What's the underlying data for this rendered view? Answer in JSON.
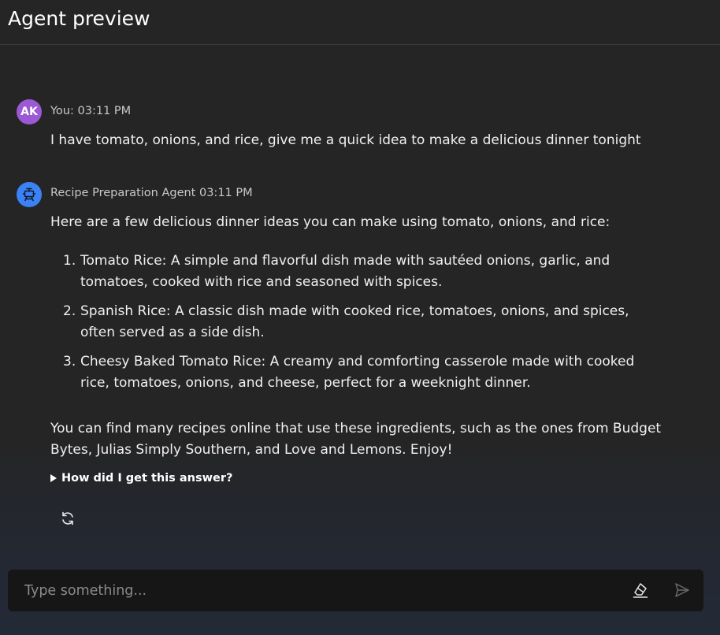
{
  "header": {
    "title": "Agent preview"
  },
  "messages": {
    "user": {
      "avatar_initials": "AK",
      "meta": "You: 03:11 PM",
      "text": "I have tomato, onions, and rice, give me a quick idea to make a delicious dinner tonight"
    },
    "agent": {
      "avatar_icon": "robot-icon",
      "meta": "Recipe Preparation Agent 03:11 PM",
      "intro": "Here are a few delicious dinner ideas you can make using tomato, onions, and rice:",
      "items": [
        {
          "num": "1.",
          "text": "Tomato Rice: A simple and flavorful dish made with sautéed onions, garlic, and tomatoes, cooked with rice and seasoned with spices."
        },
        {
          "num": "2.",
          "text": "Spanish Rice: A classic dish made with cooked rice, tomatoes, onions, and spices, often served as a side dish."
        },
        {
          "num": "3.",
          "text": "Cheesy Baked Tomato Rice: A creamy and comforting casserole made with cooked rice, tomatoes, onions, and cheese, perfect for a weeknight dinner."
        }
      ],
      "closing": "You can find many recipes online that use these ingredients, such as the ones from Budget Bytes, Julias Simply Southern, and Love and Lemons. Enjoy!",
      "details_label": "How did I get this answer?"
    }
  },
  "input": {
    "placeholder": "Type something...",
    "value": ""
  },
  "icons": {
    "refresh": "refresh-icon",
    "eraser": "eraser-icon",
    "send": "send-icon"
  },
  "colors": {
    "user_avatar": "#9b59d6",
    "agent_avatar": "#3b82f6",
    "input_bg": "#161616"
  }
}
